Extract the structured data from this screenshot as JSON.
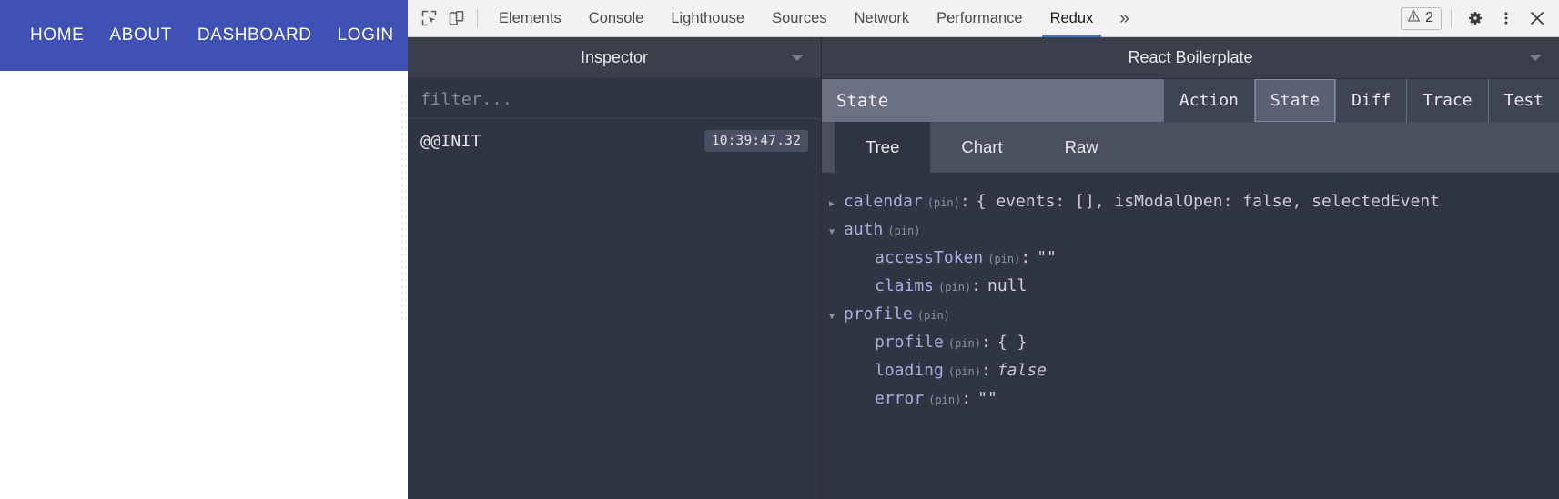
{
  "page": {
    "nav_links": [
      {
        "label": "HOME",
        "name": "nav-link-home"
      },
      {
        "label": "ABOUT",
        "name": "nav-link-about"
      },
      {
        "label": "DASHBOARD",
        "name": "nav-link-dashboard"
      },
      {
        "label": "LOGIN",
        "name": "nav-link-login"
      }
    ],
    "navbar_color": "#3f51b5"
  },
  "devtools": {
    "icons": {
      "inspect": "inspect-element-icon",
      "device": "device-toolbar-icon",
      "more_tabs": "»",
      "warning": "warning-triangle-icon",
      "settings": "gear-icon",
      "menu": "kebab-menu-icon",
      "close": "close-icon"
    },
    "tabs": [
      {
        "label": "Elements",
        "active": false
      },
      {
        "label": "Console",
        "active": false
      },
      {
        "label": "Lighthouse",
        "active": false
      },
      {
        "label": "Sources",
        "active": false
      },
      {
        "label": "Network",
        "active": false
      },
      {
        "label": "Performance",
        "active": false
      },
      {
        "label": "Redux",
        "active": true
      }
    ],
    "warning_count": "2",
    "active_tab_underline_color": "#3b72d9"
  },
  "redux": {
    "left": {
      "header_title": "Inspector",
      "filter_placeholder": "filter...",
      "filter_value": "",
      "actions": [
        {
          "name": "@@INIT",
          "time": "10:39:47.32"
        }
      ]
    },
    "right": {
      "header_title": "React Boilerplate",
      "section_label": "State",
      "segments": [
        {
          "label": "Action",
          "active": false
        },
        {
          "label": "State",
          "active": true
        },
        {
          "label": "Diff",
          "active": false
        },
        {
          "label": "Trace",
          "active": false
        },
        {
          "label": "Test",
          "active": false
        }
      ],
      "tabs": [
        {
          "label": "Tree",
          "active": true
        },
        {
          "label": "Chart",
          "active": false
        },
        {
          "label": "Raw",
          "active": false
        }
      ],
      "tree": [
        {
          "level": 1,
          "arrow": "collapsed",
          "key": "calendar",
          "pin": "(pin)",
          "colon": ":",
          "value": "{ events: [], isModalOpen: false, selectedEvent",
          "value_style": "plain"
        },
        {
          "level": 1,
          "arrow": "expanded",
          "key": "auth",
          "pin": "(pin)",
          "colon": "",
          "value": "",
          "value_style": "plain"
        },
        {
          "level": 2,
          "arrow": "none",
          "key": "accessToken",
          "pin": "(pin)",
          "colon": ":",
          "value": "\"\"",
          "value_style": "str"
        },
        {
          "level": 2,
          "arrow": "none",
          "key": "claims",
          "pin": "(pin)",
          "colon": ":",
          "value": "null",
          "value_style": "nul"
        },
        {
          "level": 1,
          "arrow": "expanded",
          "key": "profile",
          "pin": "(pin)",
          "colon": "",
          "value": "",
          "value_style": "plain"
        },
        {
          "level": 2,
          "arrow": "none",
          "key": "profile",
          "pin": "(pin)",
          "colon": ":",
          "value": "{ }",
          "value_style": "plain"
        },
        {
          "level": 2,
          "arrow": "none",
          "key": "loading",
          "pin": "(pin)",
          "colon": ":",
          "value": "false",
          "value_style": "ital"
        },
        {
          "level": 2,
          "arrow": "none",
          "key": "error",
          "pin": "(pin)",
          "colon": ":",
          "value": "\"\"",
          "value_style": "str"
        }
      ]
    }
  },
  "colors": {
    "brand_blue": "#3f51b5",
    "devtools_bg": "#f2f2f2",
    "redux_bg": "#2f3542",
    "redux_panel": "#3a3f4b",
    "redux_subbar": "#6b7083",
    "key_color": "#a5b2e0",
    "tab_underline": "#3b72d9"
  }
}
